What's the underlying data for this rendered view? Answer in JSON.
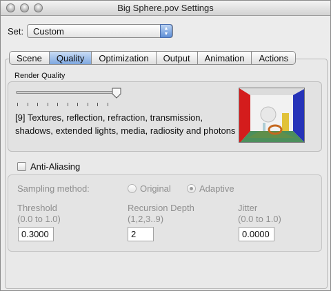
{
  "window": {
    "title": "Big Sphere.pov Settings"
  },
  "set": {
    "label": "Set:",
    "value": "Custom"
  },
  "tabs": [
    "Scene",
    "Quality",
    "Optimization",
    "Output",
    "Animation",
    "Actions"
  ],
  "selected_tab": "Quality",
  "render_quality": {
    "label": "Render Quality",
    "level": 9,
    "level_max": 11,
    "description": "[9] Textures, reflection, refraction, transmission, shadows, extended lights, media, radiosity and photons"
  },
  "anti_aliasing": {
    "label": "Anti-Aliasing",
    "checked": false,
    "sampling_label": "Sampling method:",
    "methods": [
      "Original",
      "Adaptive"
    ],
    "selected_method": "Adaptive",
    "threshold": {
      "label": "Threshold",
      "range": "(0.0 to 1.0)",
      "value": "0.3000"
    },
    "recursion": {
      "label": "Recursion Depth",
      "range": "(1,2,3..9)",
      "value": "2"
    },
    "jitter": {
      "label": "Jitter",
      "range": "(0.0 to 1.0)",
      "value": "0.0000"
    }
  }
}
